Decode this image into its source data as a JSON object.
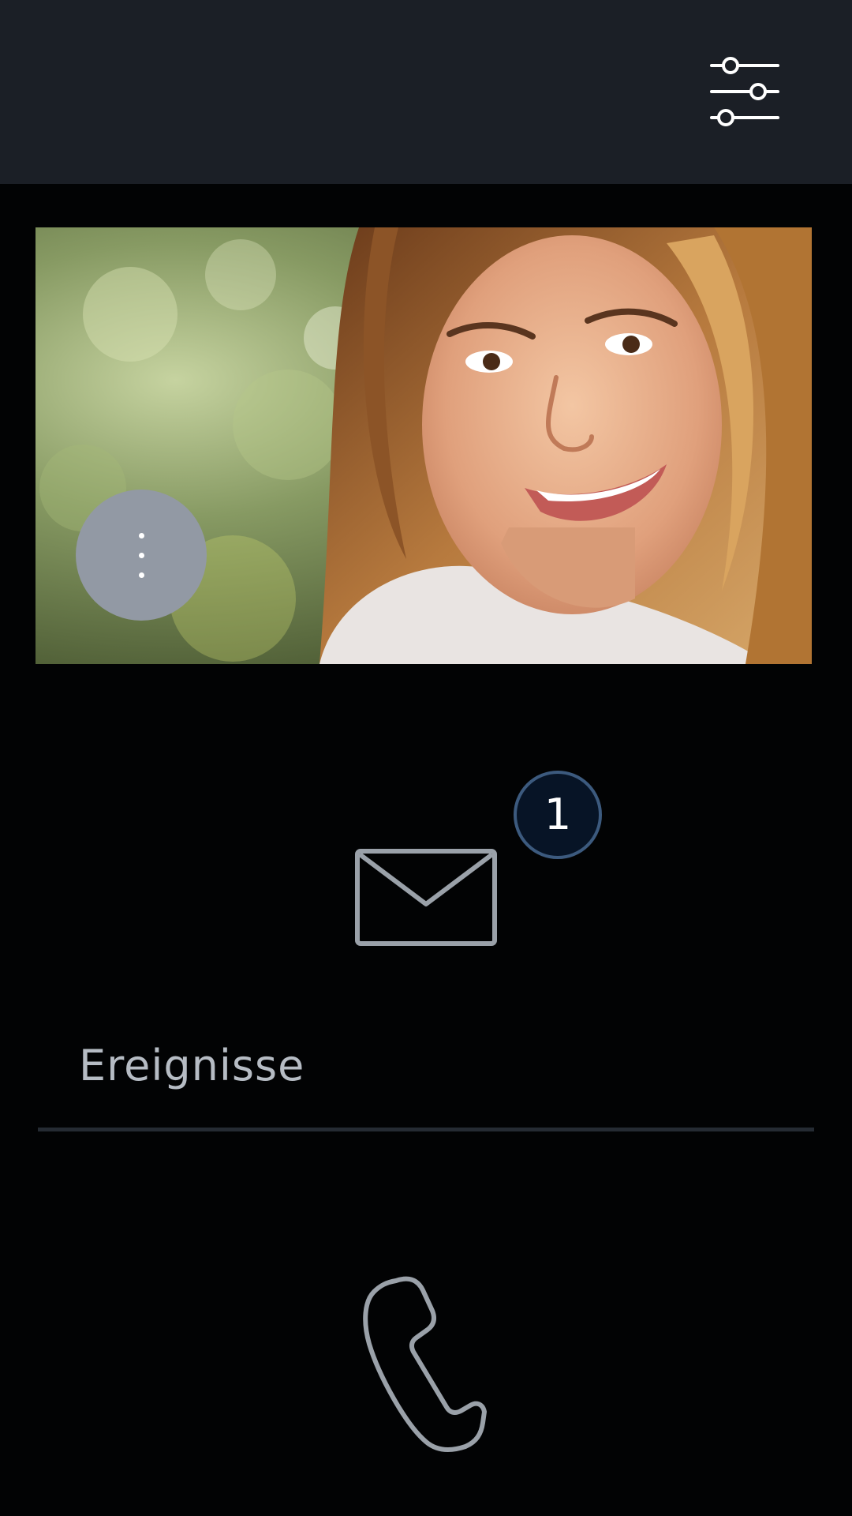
{
  "header": {
    "settings_icon": "sliders-icon"
  },
  "video": {
    "menu_icon": "vertical-dots-icon"
  },
  "events": {
    "icon": "envelope-icon",
    "badge_count": "1",
    "label": "Ereignisse"
  },
  "call": {
    "icon": "phone-handset-icon"
  },
  "colors": {
    "background": "#020304",
    "topbar": "#1b1f26",
    "icon_gray": "#9aa1a9",
    "badge_fill": "#071426",
    "badge_border": "#3c5a7e",
    "divider": "#252b33"
  }
}
